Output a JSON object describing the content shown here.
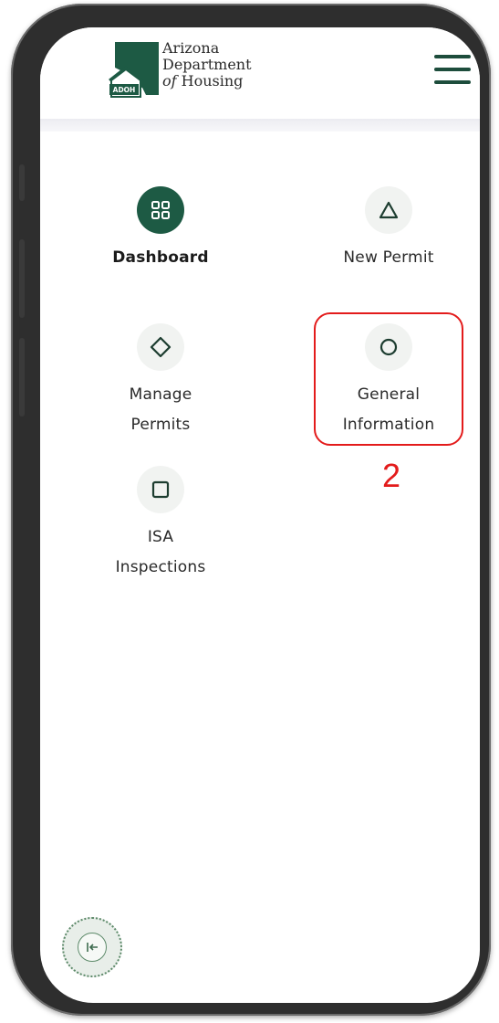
{
  "header": {
    "logo_badge": "ADOH",
    "org_line1": "Arizona",
    "org_line2": "Department",
    "org_line3_prefix": "of",
    "org_line3_rest": "Housing",
    "menu_icon": "hamburger-icon"
  },
  "nav": {
    "items": [
      {
        "label": "Dashboard",
        "icon": "grid-icon",
        "active": true
      },
      {
        "label": "New Permit",
        "icon": "triangle-icon",
        "active": false
      },
      {
        "label_line1": "Manage",
        "label_line2": "Permits",
        "icon": "diamond-icon",
        "active": false
      },
      {
        "label_line1": "General",
        "label_line2": "Information",
        "icon": "circle-icon",
        "active": false
      },
      {
        "label_line1": "ISA",
        "label_line2": "Inspections",
        "icon": "square-icon",
        "active": false
      }
    ]
  },
  "annotation": {
    "step": "2",
    "color": "#e31b1b"
  },
  "sidebar": {
    "collapse_icon": "collapse-left-icon"
  },
  "colors": {
    "brand_green": "#1d5a44",
    "icon_bg": "#f1f3f1"
  }
}
